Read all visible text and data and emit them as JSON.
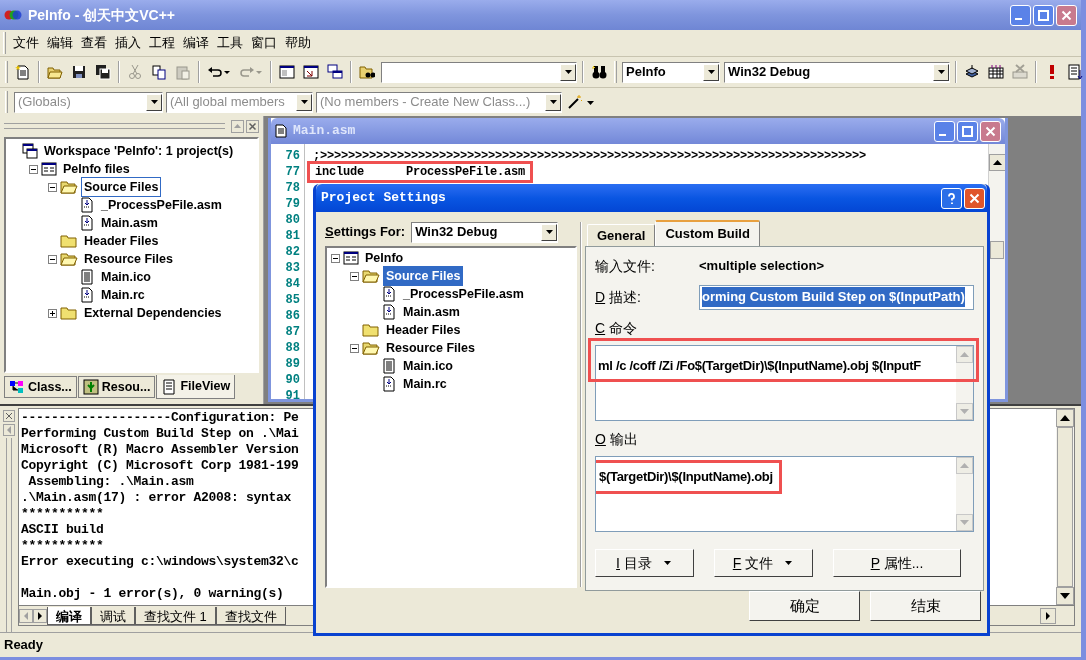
{
  "window": {
    "title": "PeInfo - 创天中文VC++"
  },
  "menu": [
    "文件",
    "编辑",
    "查看",
    "插入",
    "工程",
    "编译",
    "工具",
    "窗口",
    "帮助"
  ],
  "toolbar": [
    {
      "kind": "button",
      "disabled": false
    },
    {
      "kind": "separator"
    },
    {
      "kind": "button",
      "disabled": false
    },
    {
      "kind": "button",
      "disabled": false
    },
    {
      "kind": "button",
      "disabled": false
    },
    {
      "kind": "separator"
    },
    {
      "kind": "button",
      "disabled": true
    },
    {
      "kind": "button",
      "disabled": false
    },
    {
      "kind": "button",
      "disabled": true
    },
    {
      "kind": "separator"
    },
    {
      "kind": "button",
      "disabled": false
    },
    {
      "kind": "button",
      "disabled": true
    },
    {
      "kind": "separator"
    },
    {
      "kind": "button",
      "disabled": false
    },
    {
      "kind": "button",
      "disabled": false
    },
    {
      "kind": "button",
      "disabled": false
    },
    {
      "kind": "separator"
    },
    {
      "kind": "button",
      "disabled": false
    },
    {
      "kind": "combo"
    },
    {
      "kind": "separator"
    },
    {
      "kind": "button",
      "disabled": false
    },
    {
      "kind": "grip"
    },
    {
      "kind": "combo",
      "value": "PeInfo"
    },
    {
      "kind": "combo",
      "value": "Win32 Debug"
    },
    {
      "kind": "separator"
    },
    {
      "kind": "button",
      "disabled": false
    },
    {
      "kind": "button",
      "disabled": false
    },
    {
      "kind": "button",
      "disabled": true
    },
    {
      "kind": "separator"
    },
    {
      "kind": "button",
      "disabled": false
    },
    {
      "kind": "button",
      "disabled": false
    }
  ],
  "wizard_bar": [
    {
      "value": "(Globals)",
      "disabled": true
    },
    {
      "value": "(All global members",
      "disabled": true
    },
    {
      "value": "(No members - Create New Class...)",
      "disabled": true
    }
  ],
  "workspace": {
    "tree": [
      {
        "label": "Workspace 'PeInfo': 1 project(s)",
        "kind": "workspace",
        "selected": false,
        "children": [
          {
            "label": "PeInfo files",
            "kind": "project",
            "selected": false,
            "expanded": true,
            "children": [
              {
                "label": "Source Files",
                "kind": "folder",
                "selected": true,
                "expanded": true,
                "children": [
                  {
                    "label": "_ProcessPeFile.asm",
                    "kind": "source",
                    "selected": false
                  },
                  {
                    "label": "Main.asm",
                    "kind": "source",
                    "selected": false
                  }
                ]
              },
              {
                "label": "Header Files",
                "kind": "folder",
                "selected": false
              },
              {
                "label": "Resource Files",
                "kind": "folder",
                "selected": false,
                "expanded": true,
                "children": [
                  {
                    "label": "Main.ico",
                    "kind": "text",
                    "selected": false
                  },
                  {
                    "label": "Main.rc",
                    "kind": "source",
                    "selected": false
                  }
                ]
              },
              {
                "label": "External Dependencies",
                "kind": "folder",
                "selected": false,
                "expanded": false
              }
            ]
          }
        ]
      }
    ],
    "tabs": [
      {
        "label": "Class...",
        "selected": false
      },
      {
        "label": "Resou...",
        "selected": false
      },
      {
        "label": "FileView",
        "selected": true
      }
    ]
  },
  "editor": {
    "title": "Main.asm",
    "lines": [
      {
        "number": "76",
        "text": ";>>>>>>>>>>>>>>>>>>>>>>>>>>>>>>>>>>>>>>>>>>>>>>>>>>>>>>>>>>>>>>>>>>>>>>>>>>>>>>",
        "highlighted": false
      },
      {
        "number": "77",
        "text": "include      ProcessPeFile.asm",
        "highlighted": true
      },
      {
        "number": "78"
      },
      {
        "number": "79"
      },
      {
        "number": "80"
      },
      {
        "number": "81"
      },
      {
        "number": "82"
      },
      {
        "number": "83"
      },
      {
        "number": "84"
      },
      {
        "number": "85"
      },
      {
        "number": "86"
      },
      {
        "number": "87"
      },
      {
        "number": "88"
      },
      {
        "number": "89"
      },
      {
        "number": "90"
      },
      {
        "number": "91"
      }
    ]
  },
  "dialog": {
    "title": "Project Settings",
    "settings_for": {
      "label": "Settings For:",
      "value": "Win32 Debug"
    },
    "tree": [
      {
        "label": "PeInfo",
        "kind": "project",
        "selected": false,
        "expanded": true,
        "children": [
          {
            "label": "Source Files",
            "kind": "folder",
            "selected": true,
            "expanded": true,
            "children": [
              {
                "label": "_ProcessPeFile.asm",
                "kind": "source",
                "selected": false
              },
              {
                "label": "Main.asm",
                "kind": "source",
                "selected": false
              }
            ]
          },
          {
            "label": "Header Files",
            "kind": "folder",
            "selected": false
          },
          {
            "label": "Resource Files",
            "kind": "folder",
            "selected": false,
            "expanded": true,
            "children": [
              {
                "label": "Main.ico",
                "kind": "text",
                "selected": false
              },
              {
                "label": "Main.rc",
                "kind": "source",
                "selected": false
              }
            ]
          }
        ]
      }
    ],
    "tabs": [
      {
        "label": "General",
        "selected": false
      },
      {
        "label": "Custom Build",
        "selected": true
      }
    ],
    "input_file": {
      "label": "输入文件:",
      "value": "<multiple selection>"
    },
    "description": {
      "label": "D 描述:",
      "value": "orming Custom Build Step on $(InputPath)",
      "text_selected": true
    },
    "command": {
      "label": "C 命令",
      "value": "ml /c /coff /Zi /Fo$(TargetDir)\\$(InputName).obj $(InputF",
      "highlighted": true
    },
    "output": {
      "label": "O 输出",
      "value": "$(TargetDir)\\$(InputName).obj",
      "highlighted": true
    },
    "action_buttons": [
      {
        "label": "I 目录",
        "dropdown": true
      },
      {
        "label": "F 文件",
        "dropdown": true
      },
      {
        "label": "P 属性...",
        "dropdown": false
      }
    ],
    "footer_buttons": [
      "确定",
      "结束"
    ]
  },
  "output": {
    "lines": [
      {
        "kind": "text",
        "text": "--------------------Configuration: Pe"
      },
      {
        "kind": "text",
        "text": "Performing Custom Build Step on .\\Mai"
      },
      {
        "kind": "text",
        "text": "Microsoft (R) Macro Assembler Version"
      },
      {
        "kind": "text",
        "text": "Copyright (C) Microsoft Corp 1981-199"
      },
      {
        "kind": "text",
        "text": " Assembling: .\\Main.asm"
      },
      {
        "kind": "text",
        "text": ".\\Main.asm(17) : error A2008: syntax"
      },
      {
        "kind": "text",
        "text": "***********"
      },
      {
        "kind": "text",
        "text": "ASCII build"
      },
      {
        "kind": "text",
        "text": "***********"
      },
      {
        "kind": "text",
        "text": "Error executing c:\\windows\\system32\\c"
      },
      {
        "kind": "blank"
      },
      {
        "kind": "text",
        "text": "Main.obj - 1 error(s), 0 warning(s)"
      }
    ],
    "tabs": [
      {
        "label": "编译",
        "selected": true
      },
      {
        "label": "调试",
        "selected": false
      },
      {
        "label": "查找文件 1",
        "selected": false
      },
      {
        "label": "查找文件",
        "selected": false
      }
    ]
  },
  "status_bar": "Ready"
}
